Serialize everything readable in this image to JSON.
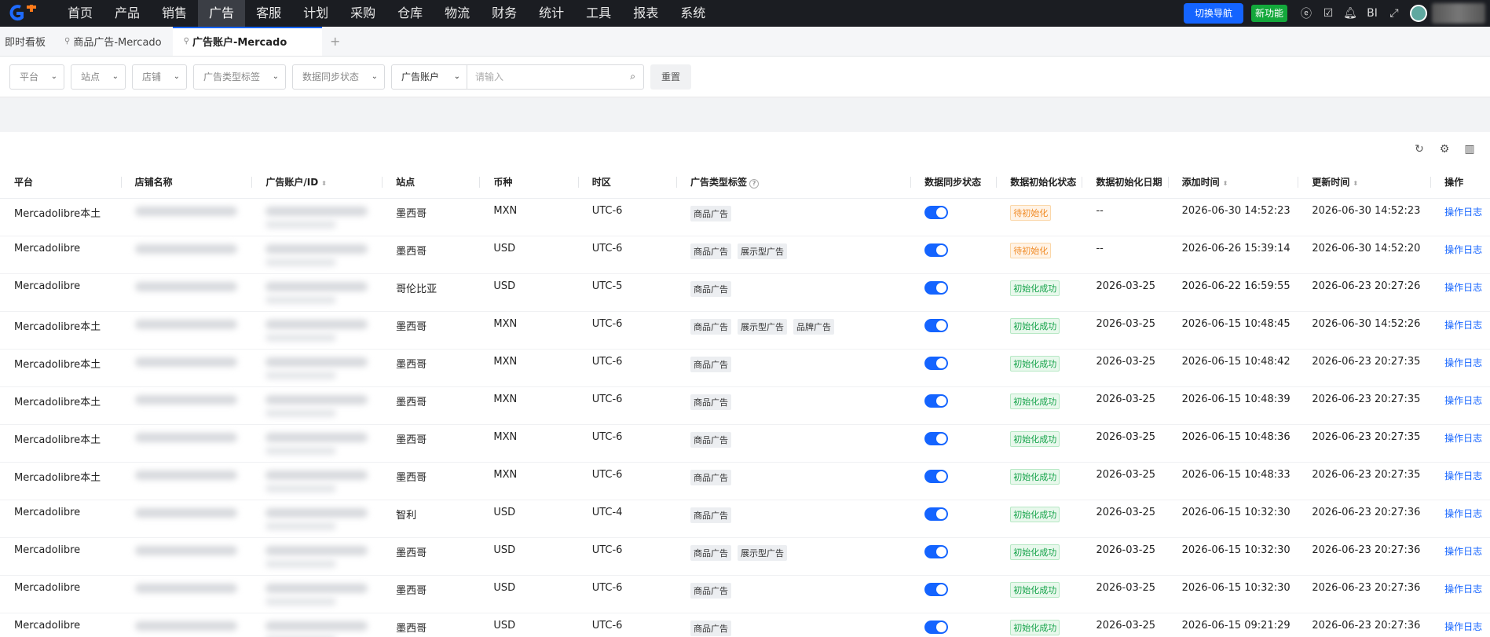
{
  "nav": {
    "items": [
      "首页",
      "产品",
      "销售",
      "广告",
      "客服",
      "计划",
      "采购",
      "仓库",
      "物流",
      "财务",
      "统计",
      "工具",
      "报表",
      "系统"
    ],
    "active_index": 3,
    "switch_nav": "切换导航",
    "new_feature": "新功能",
    "bi": "BI"
  },
  "tabs": {
    "dashboard": "即时看板",
    "product_ads": "商品广告-Mercado",
    "ad_accounts": "广告账户-Mercado",
    "add": "+"
  },
  "filters": {
    "platform": "平台",
    "site": "站点",
    "shop": "店铺",
    "ad_type_tag": "广告类型标签",
    "sync_status": "数据同步状态",
    "search_field": "广告账户",
    "search_placeholder": "请输入",
    "reset": "重置"
  },
  "table": {
    "headers": {
      "platform": "平台",
      "shop": "店铺名称",
      "account": "广告账户/ID",
      "site": "站点",
      "currency": "币种",
      "timezone": "时区",
      "ad_tags": "广告类型标签",
      "sync": "数据同步状态",
      "init_status": "数据初始化状态",
      "init_date": "数据初始化日期",
      "added": "添加时间",
      "updated": "更新时间",
      "action": "操作"
    },
    "rows": [
      {
        "platform": "Mercadolibre本土",
        "site": "墨西哥",
        "currency": "MXN",
        "tz": "UTC-6",
        "tags": [
          "商品广告"
        ],
        "init_status": "待初始化",
        "init_kind": "pending",
        "init_date": "--",
        "added": "2026-06-30 14:52:23",
        "updated": "2026-06-30 14:52:23",
        "action": "操作日志"
      },
      {
        "platform": "Mercadolibre",
        "site": "墨西哥",
        "currency": "USD",
        "tz": "UTC-6",
        "tags": [
          "商品广告",
          "展示型广告"
        ],
        "init_status": "待初始化",
        "init_kind": "pending",
        "init_date": "--",
        "added": "2026-06-26 15:39:14",
        "updated": "2026-06-30 14:52:20",
        "action": "操作日志"
      },
      {
        "platform": "Mercadolibre",
        "site": "哥伦比亚",
        "currency": "USD",
        "tz": "UTC-5",
        "tags": [
          "商品广告"
        ],
        "init_status": "初始化成功",
        "init_kind": "ok",
        "init_date": "2026-03-25",
        "added": "2026-06-22 16:59:55",
        "updated": "2026-06-23 20:27:26",
        "action": "操作日志"
      },
      {
        "platform": "Mercadolibre本土",
        "site": "墨西哥",
        "currency": "MXN",
        "tz": "UTC-6",
        "tags": [
          "商品广告",
          "展示型广告",
          "品牌广告"
        ],
        "init_status": "初始化成功",
        "init_kind": "ok",
        "init_date": "2026-03-25",
        "added": "2026-06-15 10:48:45",
        "updated": "2026-06-30 14:52:26",
        "action": "操作日志"
      },
      {
        "platform": "Mercadolibre本土",
        "site": "墨西哥",
        "currency": "MXN",
        "tz": "UTC-6",
        "tags": [
          "商品广告"
        ],
        "init_status": "初始化成功",
        "init_kind": "ok",
        "init_date": "2026-03-25",
        "added": "2026-06-15 10:48:42",
        "updated": "2026-06-23 20:27:35",
        "action": "操作日志"
      },
      {
        "platform": "Mercadolibre本土",
        "site": "墨西哥",
        "currency": "MXN",
        "tz": "UTC-6",
        "tags": [
          "商品广告"
        ],
        "init_status": "初始化成功",
        "init_kind": "ok",
        "init_date": "2026-03-25",
        "added": "2026-06-15 10:48:39",
        "updated": "2026-06-23 20:27:35",
        "action": "操作日志"
      },
      {
        "platform": "Mercadolibre本土",
        "site": "墨西哥",
        "currency": "MXN",
        "tz": "UTC-6",
        "tags": [
          "商品广告"
        ],
        "init_status": "初始化成功",
        "init_kind": "ok",
        "init_date": "2026-03-25",
        "added": "2026-06-15 10:48:36",
        "updated": "2026-06-23 20:27:35",
        "action": "操作日志"
      },
      {
        "platform": "Mercadolibre本土",
        "site": "墨西哥",
        "currency": "MXN",
        "tz": "UTC-6",
        "tags": [
          "商品广告"
        ],
        "init_status": "初始化成功",
        "init_kind": "ok",
        "init_date": "2026-03-25",
        "added": "2026-06-15 10:48:33",
        "updated": "2026-06-23 20:27:35",
        "action": "操作日志"
      },
      {
        "platform": "Mercadolibre",
        "site": "智利",
        "currency": "USD",
        "tz": "UTC-4",
        "tags": [
          "商品广告"
        ],
        "init_status": "初始化成功",
        "init_kind": "ok",
        "init_date": "2026-03-25",
        "added": "2026-06-15 10:32:30",
        "updated": "2026-06-23 20:27:36",
        "action": "操作日志"
      },
      {
        "platform": "Mercadolibre",
        "site": "墨西哥",
        "currency": "USD",
        "tz": "UTC-6",
        "tags": [
          "商品广告",
          "展示型广告"
        ],
        "init_status": "初始化成功",
        "init_kind": "ok",
        "init_date": "2026-03-25",
        "added": "2026-06-15 10:32:30",
        "updated": "2026-06-23 20:27:36",
        "action": "操作日志"
      },
      {
        "platform": "Mercadolibre",
        "site": "墨西哥",
        "currency": "USD",
        "tz": "UTC-6",
        "tags": [
          "商品广告"
        ],
        "init_status": "初始化成功",
        "init_kind": "ok",
        "init_date": "2026-03-25",
        "added": "2026-06-15 10:32:30",
        "updated": "2026-06-23 20:27:36",
        "action": "操作日志"
      },
      {
        "platform": "Mercadolibre",
        "site": "墨西哥",
        "currency": "USD",
        "tz": "UTC-6",
        "tags": [
          "商品广告"
        ],
        "init_status": "初始化成功",
        "init_kind": "ok",
        "init_date": "2026-03-25",
        "added": "2026-06-15 09:21:29",
        "updated": "2026-06-23 20:27:36",
        "action": "操作日志"
      }
    ]
  },
  "colors": {
    "accent": "#1464ff",
    "nav_bg": "#1b1d22",
    "success": "#16a34a",
    "pending": "#f08a24",
    "new_feature": "#13a83b"
  }
}
